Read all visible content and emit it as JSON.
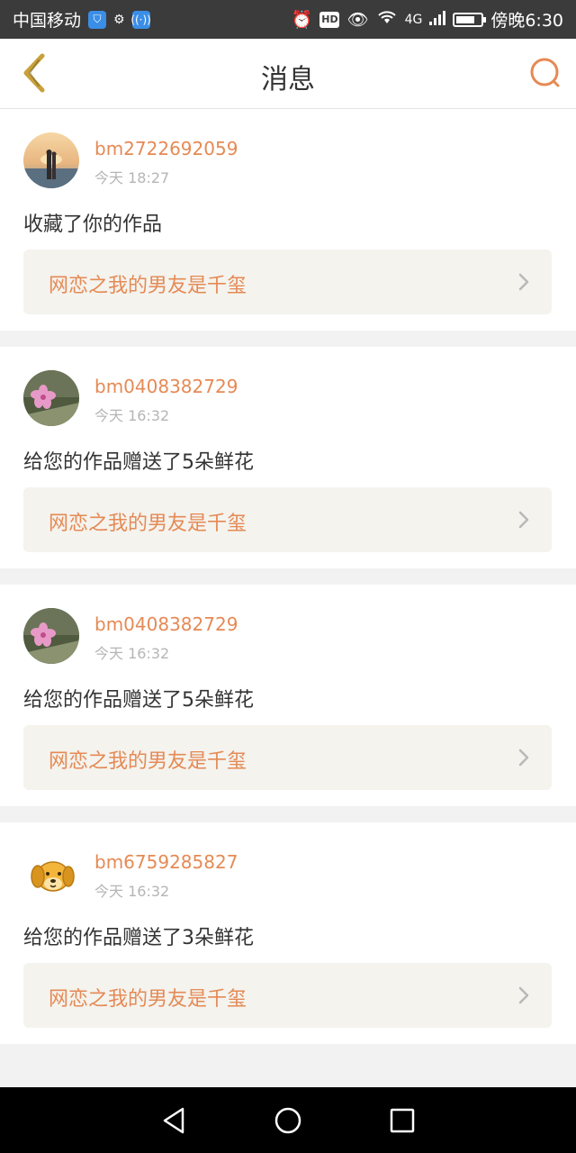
{
  "status_bar": {
    "carrier": "中国移动",
    "network": "4G",
    "time_label": "傍晚6:30",
    "hd": "HD"
  },
  "header": {
    "title": "消息",
    "accent_color": "#e58a55"
  },
  "messages": [
    {
      "username": "bm2722692059",
      "time": "今天 18:27",
      "action": "收藏了你的作品",
      "work_title": "网恋之我的男友是千玺",
      "avatar_icon": "couple-photo-avatar"
    },
    {
      "username": "bm0408382729",
      "time": "今天 16:32",
      "action": "给您的作品赠送了5朵鲜花",
      "work_title": "网恋之我的男友是千玺",
      "avatar_icon": "flower-photo-avatar"
    },
    {
      "username": "bm0408382729",
      "time": "今天 16:32",
      "action": "给您的作品赠送了5朵鲜花",
      "work_title": "网恋之我的男友是千玺",
      "avatar_icon": "flower-photo-avatar"
    },
    {
      "username": "bm6759285827",
      "time": "今天 16:32",
      "action": "给您的作品赠送了3朵鲜花",
      "work_title": "网恋之我的男友是千玺",
      "avatar_icon": "dog-cartoon-avatar"
    }
  ]
}
